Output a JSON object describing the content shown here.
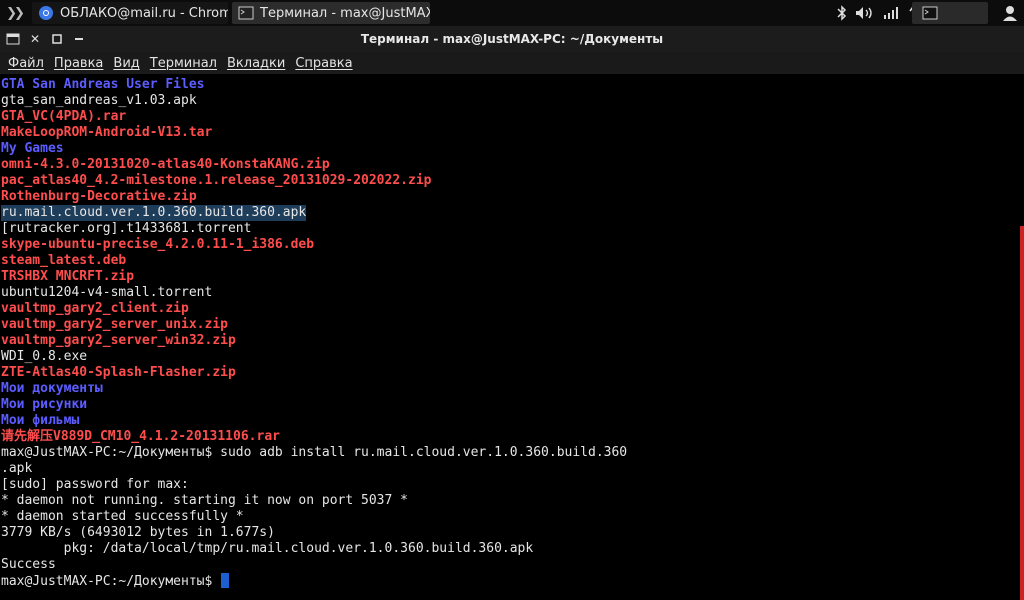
{
  "taskbar": {
    "tasks": [
      {
        "label": "ОБЛАКО@mail.ru - Chromi",
        "icon": "chromium-icon"
      },
      {
        "label": "Терминал - max@JustMAX...",
        "icon": "terminal-icon"
      }
    ],
    "tray_icons": [
      "bluetooth-icon",
      "volume-icon",
      "wifi-icon",
      "network-transfer-icon",
      "terminal-icon",
      "user-icon"
    ]
  },
  "window": {
    "title": "Терминал - max@JustMAX-PC: ~/Документы"
  },
  "menubar": {
    "items": [
      "Файл",
      "Правка",
      "Вид",
      "Терминал",
      "Вкладки",
      "Справка"
    ]
  },
  "terminal": {
    "lines": [
      {
        "text": "GTA San Andreas User Files",
        "kind": "dir"
      },
      {
        "text": "gta_san_andreas_v1.03.apk",
        "kind": "file"
      },
      {
        "text": "GTA_VC(4PDA).rar",
        "kind": "arc"
      },
      {
        "text": "MakeLoopROM-Android-V13.tar",
        "kind": "arc"
      },
      {
        "text": "My Games",
        "kind": "dir"
      },
      {
        "text": "omni-4.3.0-20131020-atlas40-KonstaKANG.zip",
        "kind": "arc"
      },
      {
        "text": "pac_atlas40_4.2-milestone.1.release_20131029-202022.zip",
        "kind": "arc"
      },
      {
        "text": "Rothenburg-Decorative.zip",
        "kind": "arc"
      },
      {
        "text": "ru.mail.cloud.ver.1.0.360.build.360.apk",
        "kind": "sel"
      },
      {
        "text": "[rutracker.org].t1433681.torrent",
        "kind": "file"
      },
      {
        "text": "skype-ubuntu-precise_4.2.0.11-1_i386.deb",
        "kind": "arc"
      },
      {
        "text": "steam_latest.deb",
        "kind": "arc"
      },
      {
        "text": "TRSHBX MNCRFT.zip",
        "kind": "arc"
      },
      {
        "text": "ubuntu1204-v4-small.torrent",
        "kind": "file"
      },
      {
        "text": "vaultmp_gary2_client.zip",
        "kind": "arc"
      },
      {
        "text": "vaultmp_gary2_server_unix.zip",
        "kind": "arc"
      },
      {
        "text": "vaultmp_gary2_server_win32.zip",
        "kind": "arc"
      },
      {
        "text": "WDI_0.8.exe",
        "kind": "file"
      },
      {
        "text": "ZTE-Atlas40-Splash-Flasher.zip",
        "kind": "arc"
      },
      {
        "text": "Мои документы",
        "kind": "dir"
      },
      {
        "text": "Мои рисунки",
        "kind": "dir"
      },
      {
        "text": "Мои фильмы",
        "kind": "dir"
      },
      {
        "text": "请先解压V889D_CM10_4.1.2-20131106.rar",
        "kind": "arc"
      },
      {
        "text": "max@JustMAX-PC:~/Документы$ sudo adb install ru.mail.cloud.ver.1.0.360.build.360",
        "kind": "file"
      },
      {
        "text": ".apk",
        "kind": "file"
      },
      {
        "text": "[sudo] password for max:",
        "kind": "file"
      },
      {
        "text": "* daemon not running. starting it now on port 5037 *",
        "kind": "file"
      },
      {
        "text": "* daemon started successfully *",
        "kind": "file"
      },
      {
        "text": "3779 KB/s (6493012 bytes in 1.677s)",
        "kind": "file"
      },
      {
        "text": "        pkg: /data/local/tmp/ru.mail.cloud.ver.1.0.360.build.360.apk",
        "kind": "file"
      },
      {
        "text": "Success",
        "kind": "file"
      }
    ],
    "prompt": "max@JustMAX-PC:~/Документы$ "
  },
  "colors": {
    "directory": "#5c5cff",
    "archive": "#ff4d4d",
    "plain": "#e6e6e6",
    "selection": "#1e3d5a",
    "cursor": "#1e5fd0",
    "scroll_thumb": "#cc2222"
  }
}
